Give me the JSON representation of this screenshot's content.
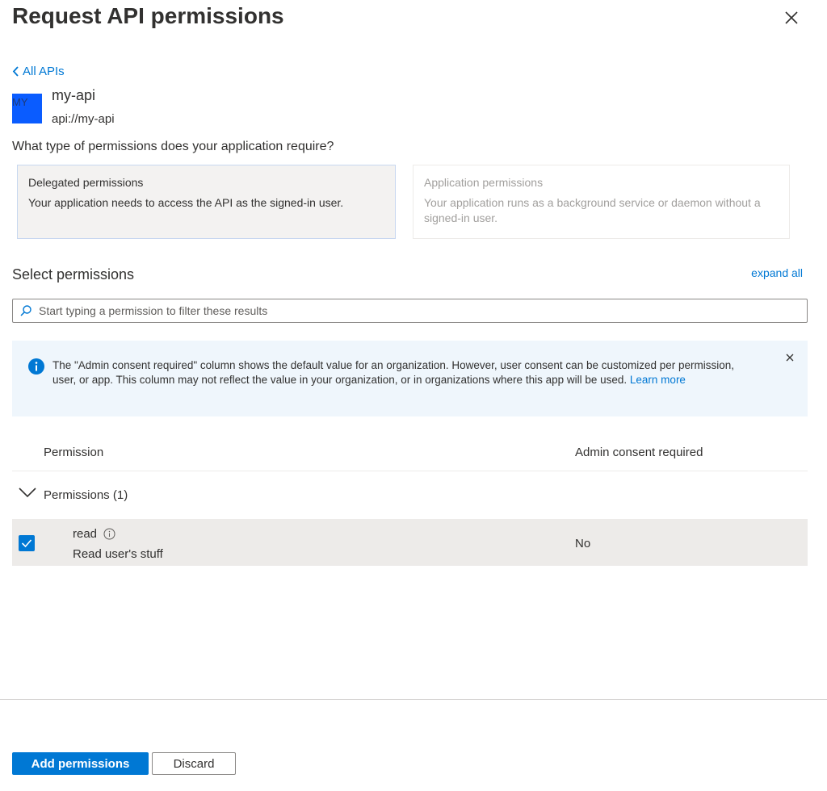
{
  "panel": {
    "title": "Request API permissions",
    "close_icon": "close-icon"
  },
  "nav": {
    "back_label": "All APIs"
  },
  "api": {
    "avatar_text": "MY",
    "avatar_color": "#0a5cff",
    "name": "my-api",
    "uri": "api://my-api"
  },
  "permission_types": {
    "question": "What type of permissions does your application require?",
    "delegated": {
      "title": "Delegated permissions",
      "description": "Your application needs to access the API as the signed-in user.",
      "selected": true
    },
    "application": {
      "title": "Application permissions",
      "description": "Your application runs as a background service or daemon without a signed-in user.",
      "selected": false
    }
  },
  "select_permissions": {
    "label": "Select permissions",
    "expand_all": "expand all",
    "search_placeholder": "Start typing a permission to filter these results",
    "search_value": ""
  },
  "info_bar": {
    "text": "The \"Admin consent required\" column shows the default value for an organization. However, user consent can be customized per permission, user, or app. This column may not reflect the value in your organization, or in organizations where this app will be used.",
    "link": "Learn more",
    "color": "#eff6fc"
  },
  "table": {
    "columns": [
      "Permission",
      "Admin consent required"
    ],
    "group": {
      "label": "Permissions (1)",
      "expanded": true
    },
    "rows": [
      {
        "name": "read",
        "description": "Read user's stuff",
        "admin_consent": "No",
        "checked": true
      }
    ]
  },
  "footer": {
    "add_label": "Add permissions",
    "discard_label": "Discard"
  },
  "colors": {
    "accent": "#0078d4",
    "text": "#323130",
    "selected_row": "#edebe9"
  }
}
